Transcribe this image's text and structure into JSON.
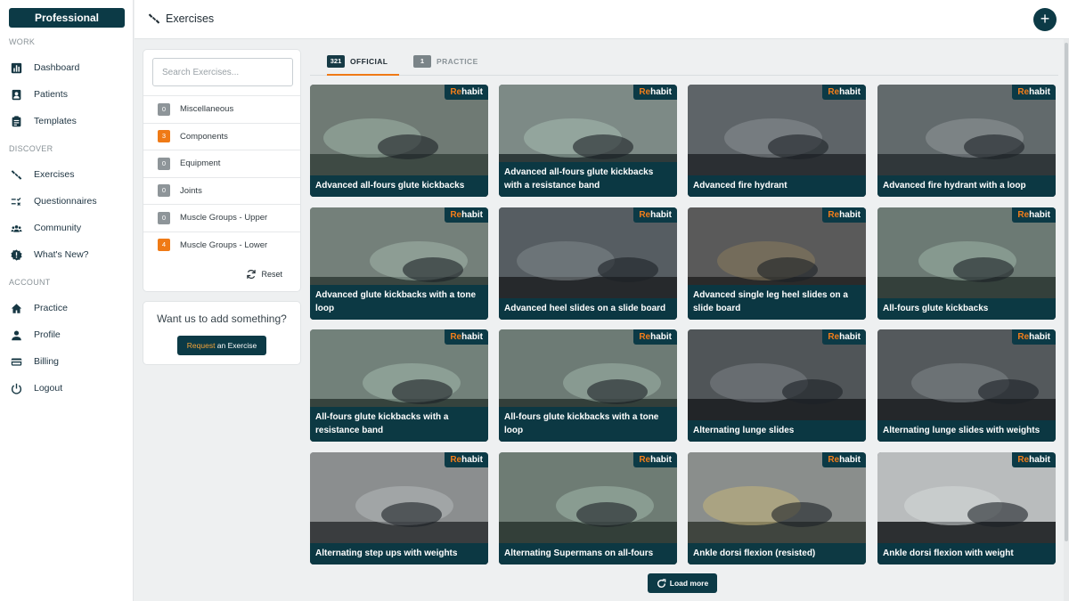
{
  "sidebar": {
    "plan_label": "Professional",
    "sections": {
      "work": "WORK",
      "discover": "DISCOVER",
      "account": "ACCOUNT"
    },
    "items": [
      {
        "label": "Dashboard",
        "icon": "bar-chart-icon"
      },
      {
        "label": "Patients",
        "icon": "patient-badge-icon"
      },
      {
        "label": "Templates",
        "icon": "clipboard-icon"
      },
      {
        "label": "Exercises",
        "icon": "dumbbell-icon"
      },
      {
        "label": "Questionnaires",
        "icon": "checklist-icon"
      },
      {
        "label": "Community",
        "icon": "group-icon"
      },
      {
        "label": "What's New?",
        "icon": "alert-badge-icon"
      },
      {
        "label": "Practice",
        "icon": "home-icon"
      },
      {
        "label": "Profile",
        "icon": "person-icon"
      },
      {
        "label": "Billing",
        "icon": "credit-card-icon"
      },
      {
        "label": "Logout",
        "icon": "power-icon"
      }
    ]
  },
  "header": {
    "title": "Exercises",
    "add_label": "+"
  },
  "filters": {
    "search_placeholder": "Search Exercises...",
    "categories": [
      {
        "count": "0",
        "name": "Miscellaneous",
        "highlight": false
      },
      {
        "count": "3",
        "name": "Components",
        "highlight": true
      },
      {
        "count": "0",
        "name": "Equipment",
        "highlight": false
      },
      {
        "count": "0",
        "name": "Joints",
        "highlight": false
      },
      {
        "count": "0",
        "name": "Muscle Groups - Upper",
        "highlight": false
      },
      {
        "count": "4",
        "name": "Muscle Groups - Lower",
        "highlight": true
      }
    ],
    "reset_label": "Reset"
  },
  "request": {
    "question": "Want us to add something?",
    "button_pre": "Request",
    "button_post": " an Exercise"
  },
  "tabs": [
    {
      "count": "321",
      "label": "OFFICIAL",
      "active": true
    },
    {
      "count": "1",
      "label": "PRACTICE",
      "active": false
    }
  ],
  "brand": {
    "first": "Re",
    "rest": "habit"
  },
  "exercises": [
    "Advanced all-fours glute kickbacks",
    "Advanced all-fours glute kickbacks with a resistance band",
    "Advanced fire hydrant",
    "Advanced fire hydrant with a loop",
    "Advanced glute kickbacks with a tone loop",
    "Advanced heel slides on a slide board",
    "Advanced single leg heel slides on a slide board",
    "All-fours glute kickbacks",
    "All-fours glute kickbacks with a resistance band",
    "All-fours glute kickbacks with a tone loop",
    "Alternating lunge slides",
    "Alternating lunge slides with weights",
    "Alternating step ups with weights",
    "Alternating Supermans on all-fours",
    "Ankle dorsi flexion (resisted)",
    "Ankle dorsi flexion with weight"
  ],
  "load_more_label": "Load more",
  "colors": {
    "primary": "#0c3a46",
    "accent": "#ef7a16",
    "neutral_badge": "#8e9599"
  }
}
